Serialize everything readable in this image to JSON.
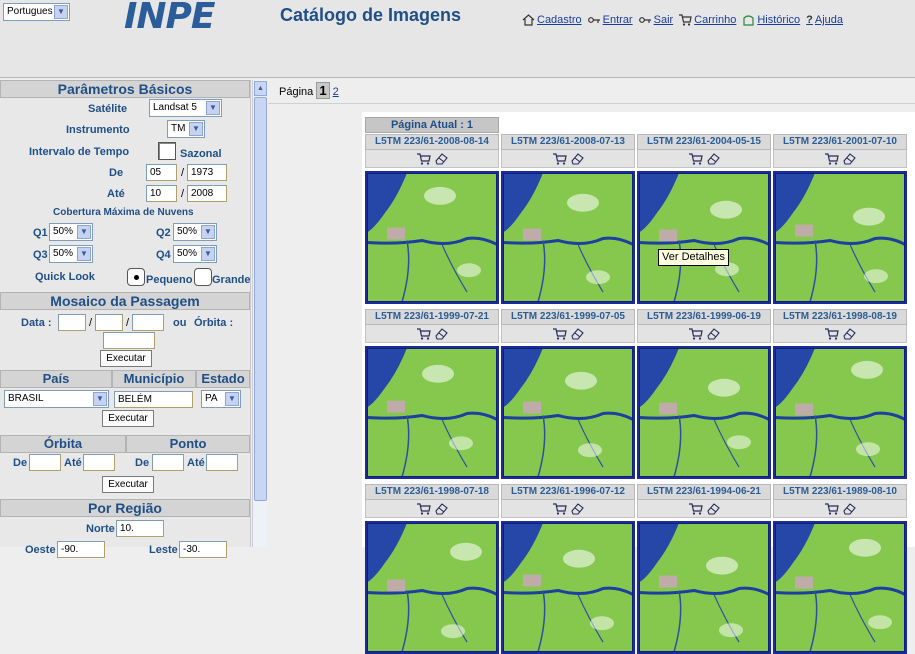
{
  "header": {
    "language": "Portugues",
    "logo": "INPE",
    "title": "Catálogo de Imagens",
    "nav": [
      {
        "label": "Cadastro",
        "icon": "home-icon"
      },
      {
        "label": "Entrar",
        "icon": "key-icon"
      },
      {
        "label": "Sair",
        "icon": "key-icon"
      },
      {
        "label": "Carrinho",
        "icon": "cart-icon"
      },
      {
        "label": "Histórico",
        "icon": "history-icon"
      },
      {
        "label": "Ajuda",
        "icon": "help-icon"
      }
    ]
  },
  "basic": {
    "heading": "Parâmetros Básicos",
    "satellite_label": "Satélite",
    "satellite": "Landsat 5",
    "instrument_label": "Instrumento",
    "instrument": "TM",
    "interval_label": "Intervalo de Tempo",
    "seasonal_label": "Sazonal",
    "from_label": "De",
    "from_month": "05",
    "from_year": "1973",
    "to_label": "Até",
    "to_month": "10",
    "to_year": "2008",
    "date_sep": "/",
    "cloud_label": "Cobertura Máxima de Nuvens",
    "q1_label": "Q1",
    "q1": "50%",
    "q2_label": "Q2",
    "q2": "50%",
    "q3_label": "Q3",
    "q3": "50%",
    "q4_label": "Q4",
    "q4": "50%",
    "quicklook_label": "Quick Look",
    "small_label": "Pequeno",
    "large_label": "Grande"
  },
  "mosaic": {
    "heading": "Mosaico da Passagem",
    "date_label": "Data :",
    "or_label": "ou",
    "orbit_label": "Órbita :",
    "execute": "Executar"
  },
  "location": {
    "country_h": "País",
    "municipality_h": "Município",
    "state_h": "Estado",
    "country": "BRASIL",
    "municipality": "BELÉM",
    "state": "PA",
    "execute": "Executar"
  },
  "orbitpoint": {
    "orbit_h": "Órbita",
    "point_h": "Ponto",
    "from_label": "De",
    "to_label": "Até",
    "execute": "Executar"
  },
  "region": {
    "heading": "Por Região",
    "north_label": "Norte",
    "north": "10.",
    "west_label": "Oeste",
    "west": "-90.",
    "east_label": "Leste",
    "east": "-30."
  },
  "pager": {
    "label": "Página",
    "current": "1",
    "next": "2"
  },
  "results": {
    "current_page_label": "Página Atual : 1",
    "tooltip": "Ver Detalhes",
    "items": [
      "L5TM 223/61-2008-08-14",
      "L5TM 223/61-2008-07-13",
      "L5TM 223/61-2004-05-15",
      "L5TM 223/61-2001-07-10",
      "L5TM 223/61-1999-07-21",
      "L5TM 223/61-1999-07-05",
      "L5TM 223/61-1999-06-19",
      "L5TM 223/61-1998-08-19",
      "L5TM 223/61-1998-07-18",
      "L5TM 223/61-1996-07-12",
      "L5TM 223/61-1994-06-21",
      "L5TM 223/61-1989-08-10"
    ]
  },
  "colors": {
    "heading_text": "#1f4f86",
    "thumb_border": "#1c2b9a",
    "vegetation": "#80c24a",
    "water": "#1d3f9e"
  }
}
